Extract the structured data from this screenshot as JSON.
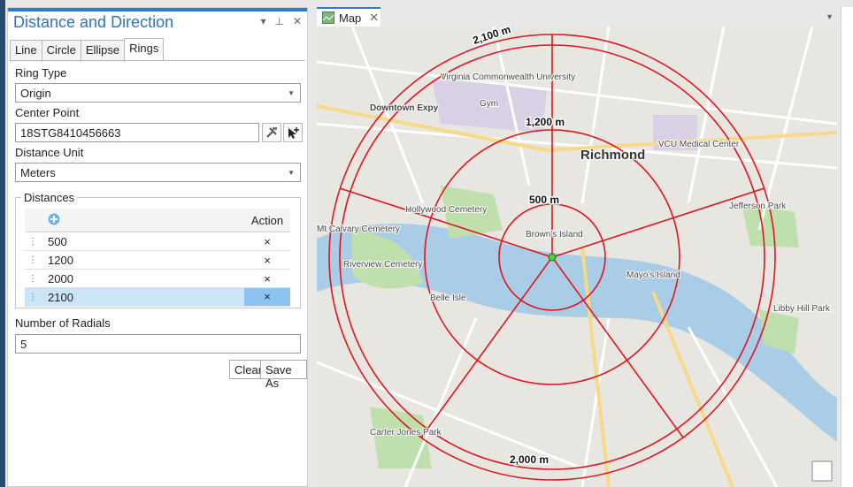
{
  "pane": {
    "title": "Distance and Direction",
    "tabs": [
      "Line",
      "Circle",
      "Ellipse",
      "Rings"
    ],
    "ring_type_label": "Ring Type",
    "ring_type_value": "Origin",
    "center_point_label": "Center Point",
    "center_point_value": "18STG8410456663",
    "distance_unit_label": "Distance Unit",
    "distance_unit_value": "Meters",
    "distances_label": "Distances",
    "table": {
      "action_header": "Action",
      "rows": [
        "500",
        "1200",
        "2000",
        "2100"
      ],
      "delete_glyph": "×"
    },
    "radials_label": "Number of Radials",
    "radials_value": "5",
    "clear_label": "Clear",
    "save_as_label": "Save As"
  },
  "map": {
    "tab_label": "Map",
    "ring_labels": [
      "2,100 m",
      "1,200 m",
      "500 m",
      "2,000 m"
    ],
    "place_labels": [
      "Richmond",
      "Virginia Commonwealth University",
      "Downtown Expy",
      "Hollywood Cemetery",
      "Mt Calvary Cemetery",
      "Riverview Cemetery",
      "Belle Isle",
      "Brown's Island",
      "Mayo's Island",
      "VCU Medical Center",
      "Jefferson Park",
      "Libby Hill Park",
      "Carter Jones Park",
      "Gym"
    ],
    "ring_color": "#e0141e",
    "center_color": "#4cd137"
  },
  "icons": {
    "close": "✕",
    "pin": "🖈",
    "caret": "▾"
  }
}
